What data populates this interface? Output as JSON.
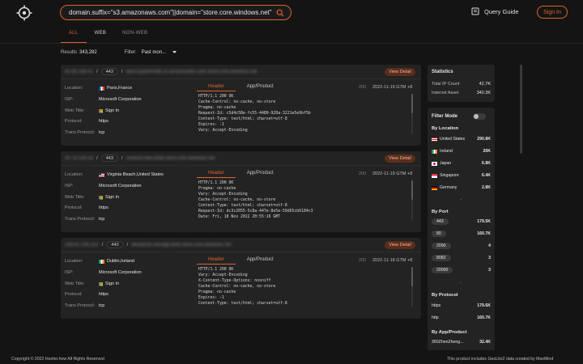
{
  "search": {
    "query": "domain.suffix=\"s3.amazonaws.com\"||domain=\"store.core.windows.net\""
  },
  "header": {
    "query_guide": "Query Guide",
    "sign_in": "Sign In"
  },
  "tabs": [
    {
      "label": "ALL",
      "active": true
    },
    {
      "label": "WEB",
      "active": false
    },
    {
      "label": "NON-WEB",
      "active": false
    }
  ],
  "results": {
    "label": "Results",
    "count": "343,282",
    "filter_label": "Filter:",
    "filter_value": "Past mon..."
  },
  "labels": {
    "location": "Location:",
    "isp": "ISP:",
    "web_title": "Web Title:",
    "protocol": "Protocol:",
    "trans_protocol": "Trans Protocol:",
    "view_detail": "View Detail",
    "header_tab": "Header",
    "app_tab": "App/Product"
  },
  "cards": [
    {
      "ip": "40.90.196.41",
      "port": "443",
      "domain": "qwe12pdsh0386.s3.amazonaws.com.store.core.windows.net",
      "location": "Paris,France",
      "flag": "fr",
      "isp": "Microsoft Corporation",
      "web_title": "Sign In",
      "protocol": "https",
      "trans_protocol": "tcp",
      "status": "200",
      "time": "2022-11-19 GTM +8",
      "response": [
        "HTTP/1.1 200 OK",
        "Cache-Control: no-cache, no-store",
        "Pragma: no-cache",
        "Request-Id: c5d4c58e-fc55-4480-928a-3221e5e9bf5b",
        "Content-Type: text/html; charset=utf-8",
        "Expires: -1",
        "Vary: Accept-Encoding"
      ]
    },
    {
      "ip": "40.78.209.33",
      "port": "443",
      "domain": "contoso-files.blob.store.core.windows.net",
      "location": "Virginia Beach,United States",
      "flag": "us",
      "isp": "Microsoft Corporation",
      "web_title": "Sign In",
      "protocol": "https",
      "trans_protocol": "tcp",
      "status": "200",
      "time": "2022-11-19 GTM +8",
      "response": [
        "HTTP/1.1 200 OK",
        "Pragma: no-cache",
        "Vary: Accept-Encoding",
        "Cache-Control: no-cache, no-store",
        "Content-Type: text/html; charset=utf-8",
        "Request-Id: dc3c2055-5c8a-447e-8e5e-59d65cb6184c3",
        "Date: Fri, 18 Nov 2022 20:55:16 GMT"
      ]
    },
    {
      "ip": "168.62.206.102",
      "port": "443",
      "domain": "ebuildcdn.storage.blob.store.core.windows.net",
      "location": "Dublin,Ireland",
      "flag": "ie",
      "isp": "Microsoft Corporation",
      "web_title": "Sign In",
      "protocol": "https",
      "trans_protocol": "tcp",
      "status": "200",
      "time": "2022-11-18 GTM +8",
      "response": [
        "HTTP/1.1 200 OK",
        "Vary: Accept-Encoding",
        "X-Content-Type-Options: nosniff",
        "Cache-Control: no-cache, no-store",
        "Pragma: no-cache",
        "Expires: -1",
        "Content-Type: text/html; charset=utf-8"
      ]
    }
  ],
  "statistics": {
    "title": "Statistics",
    "rows": [
      {
        "label": "Total IP Count",
        "value": "42.7K"
      },
      {
        "label": "Internet Asset",
        "value": "340.3K"
      }
    ]
  },
  "filters": {
    "mode_label": "Filter Mode",
    "by_location": {
      "title": "By Location",
      "items": [
        {
          "label": "United States",
          "flag": "us",
          "count": "290.8K"
        },
        {
          "label": "Ireland",
          "flag": "ie",
          "count": "26K"
        },
        {
          "label": "Japan",
          "flag": "jp",
          "count": "6.8K"
        },
        {
          "label": "Singapore",
          "flag": "sg",
          "count": "6.4K"
        },
        {
          "label": "Germany",
          "flag": "de",
          "count": "2.8K"
        }
      ]
    },
    "by_port": {
      "title": "By Port",
      "items": [
        {
          "label": "443",
          "count": "179.5K"
        },
        {
          "label": "80",
          "count": "160.7K"
        },
        {
          "label": "2000",
          "count": "4"
        },
        {
          "label": "8082",
          "count": "3"
        },
        {
          "label": "20000",
          "count": "3"
        }
      ]
    },
    "by_protocol": {
      "title": "By Protocol",
      "items": [
        {
          "label": "https",
          "count": "179.6K"
        },
        {
          "label": "http",
          "count": "160.7K"
        }
      ]
    },
    "by_app": {
      "title": "By App/Product",
      "items": [
        {
          "label": "360ZhenZheng...",
          "count": "32.4K"
        }
      ]
    }
  },
  "footer": {
    "copyright": "Copyright © 2022 Hunter.how All Rights Reserved",
    "notice": "This product includes GeoLite2 data created by MaxMind"
  }
}
